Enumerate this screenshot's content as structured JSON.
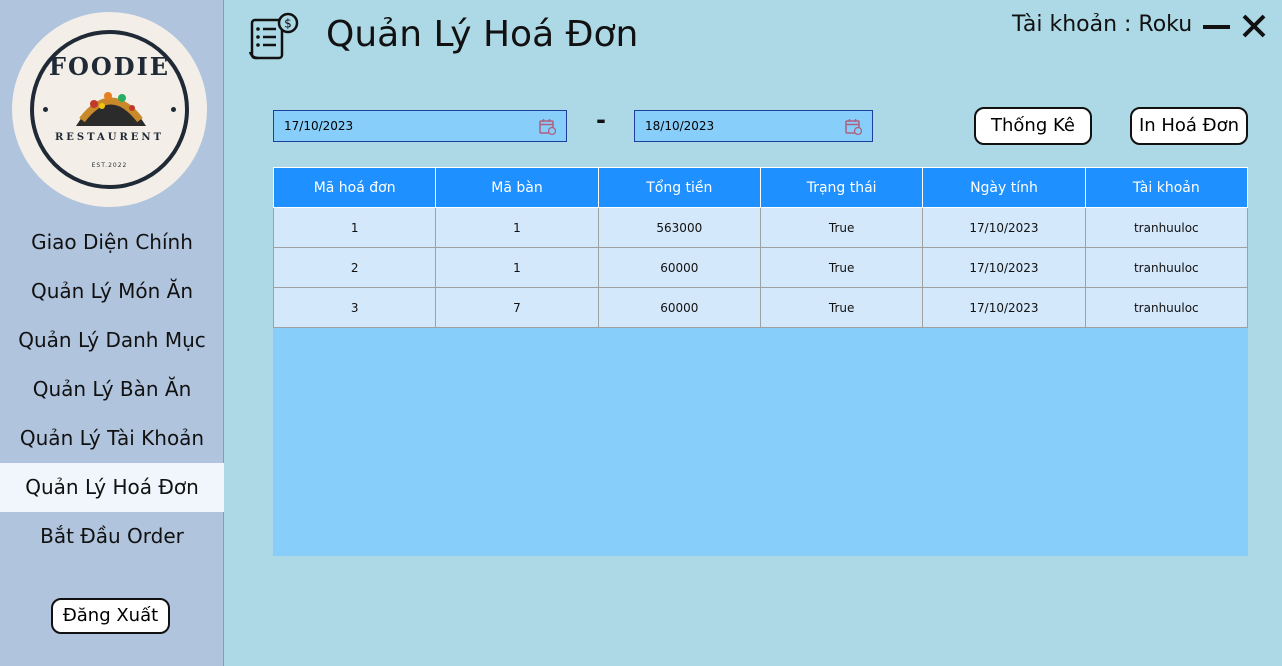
{
  "logo": {
    "name": "FOODIE",
    "tagline": "RESTAURENT",
    "est": "EST.2022"
  },
  "sidebar": {
    "items": [
      {
        "label": "Giao Diện Chính",
        "active": false
      },
      {
        "label": "Quản Lý Món Ăn",
        "active": false
      },
      {
        "label": "Quản Lý Danh Mục",
        "active": false
      },
      {
        "label": "Quản Lý Bàn Ăn",
        "active": false
      },
      {
        "label": "Quản Lý Tài Khoản",
        "active": false
      },
      {
        "label": "Quản Lý Hoá Đơn",
        "active": true
      },
      {
        "label": "Bắt Đầu Order",
        "active": false
      }
    ],
    "logout_label": "Đăng Xuất"
  },
  "header": {
    "title": "Quản Lý Hoá Đơn",
    "account_text": "Tài khoản : Roku"
  },
  "filters": {
    "from_date": "17/10/2023",
    "separator": "-",
    "to_date": "18/10/2023",
    "stats_label": "Thống Kê",
    "print_label": "In Hoá Đơn"
  },
  "table": {
    "columns": [
      "Mã hoá đơn",
      "Mã bàn",
      "Tổng tiền",
      "Trạng thái",
      "Ngày tính",
      "Tài khoản"
    ],
    "rows": [
      [
        "1",
        "1",
        "563000",
        "True",
        "17/10/2023",
        "tranhuuloc"
      ],
      [
        "2",
        "1",
        "60000",
        "True",
        "17/10/2023",
        "tranhuuloc"
      ],
      [
        "3",
        "7",
        "60000",
        "True",
        "17/10/2023",
        "tranhuuloc"
      ]
    ]
  },
  "colors": {
    "page_bg": "#add8e6",
    "sidebar_bg": "#b0c4de",
    "header_row": "#1e90ff",
    "grid_bg": "#87cefa",
    "cell_bg": "#d4e8fb"
  }
}
